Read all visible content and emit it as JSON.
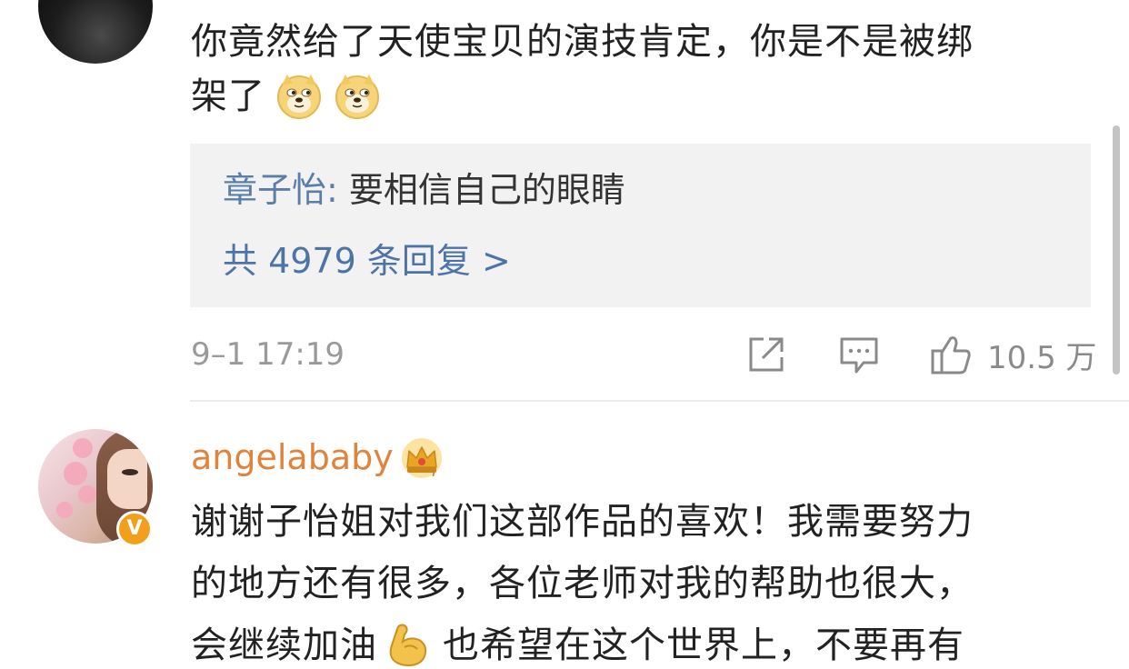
{
  "comment1": {
    "text_line1": "你竟然给了天使宝贝的演技肯定，你是不是被绑",
    "text_line2": "架了",
    "emojis": [
      "doge-emoji",
      "doge-emoji"
    ],
    "reply": {
      "user": "章子怡",
      "separator": ": ",
      "text": "要相信自己的眼睛",
      "more": "共 4979 条回复 >"
    },
    "time": "9–1 17:19",
    "like_count": "10.5 万"
  },
  "comment2": {
    "username": "angelababy",
    "badge_letter": "V",
    "text_line1": "谢谢子怡姐对我们这部作品的喜欢！我需要努力",
    "text_line2": "的地方还有很多，各位老师对我的帮助也很大，",
    "text_line3a": "会继续加油",
    "text_line3b": "也希望在这个世界上，不要再有",
    "emoji": "flexed-biceps-emoji"
  },
  "colors": {
    "username": "#e0843c",
    "reply_user": "#5b7ea8",
    "link": "#4e74a6",
    "meta": "#9a9a9a",
    "text": "#222222",
    "reply_bg": "#f2f2f2"
  }
}
